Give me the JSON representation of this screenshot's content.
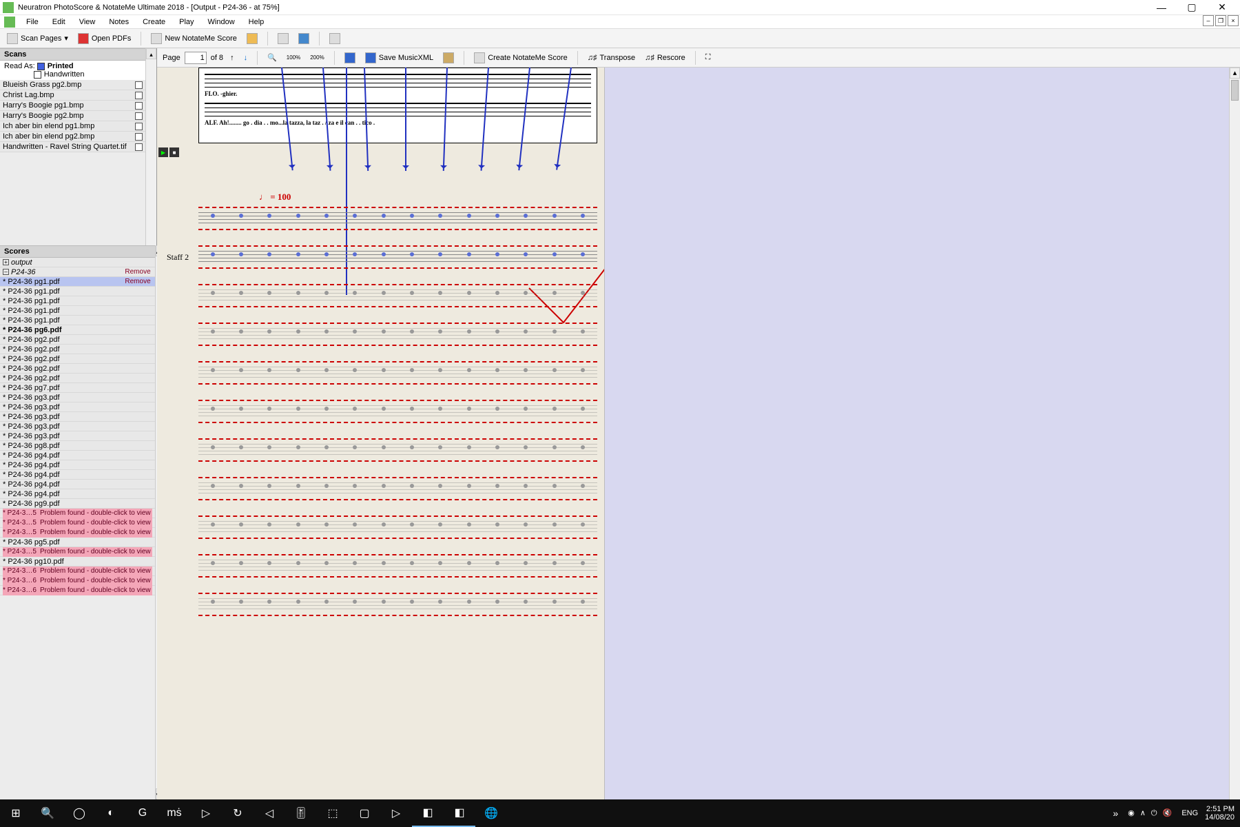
{
  "window": {
    "title": "Neuratron PhotoScore & NotateMe Ultimate 2018 - [Output - P24-36 - at 75%]",
    "min": "—",
    "max": "▢",
    "close": "✕"
  },
  "menu": {
    "items": [
      "File",
      "Edit",
      "View",
      "Notes",
      "Create",
      "Play",
      "Window",
      "Help"
    ]
  },
  "toolbar1": {
    "scan": "Scan Pages",
    "dd": "▾",
    "open": "Open PDFs",
    "newnm": "New NotateMe Score"
  },
  "scans": {
    "header": "Scans",
    "readas_label": "Read As:",
    "printed": "Printed",
    "handwritten": "Handwritten",
    "items": [
      "Blueish Grass pg2.bmp",
      "Christ Lag.bmp",
      "Harry's Boogie pg1.bmp",
      "Harry's Boogie pg2.bmp",
      "Ich aber bin elend pg1.bmp",
      "Ich aber bin elend pg2.bmp",
      "Handwritten - Ravel String Quartet.tif"
    ]
  },
  "scores": {
    "header": "Scores",
    "remove": "Remove",
    "output": "output",
    "current": "P24-36",
    "pages": [
      {
        "n": "* P24-36 pg1.pdf",
        "sel": true,
        "rem": true
      },
      {
        "n": "* P24-36 pg1.pdf"
      },
      {
        "n": "* P24-36 pg1.pdf"
      },
      {
        "n": "* P24-36 pg1.pdf"
      },
      {
        "n": "* P24-36 pg1.pdf"
      },
      {
        "n": "* P24-36 pg6.pdf",
        "bold": true
      },
      {
        "n": "* P24-36 pg2.pdf"
      },
      {
        "n": "* P24-36 pg2.pdf"
      },
      {
        "n": "* P24-36 pg2.pdf"
      },
      {
        "n": "* P24-36 pg2.pdf"
      },
      {
        "n": "* P24-36 pg2.pdf"
      },
      {
        "n": "* P24-36 pg7.pdf"
      },
      {
        "n": "* P24-36 pg3.pdf"
      },
      {
        "n": "* P24-36 pg3.pdf"
      },
      {
        "n": "* P24-36 pg3.pdf"
      },
      {
        "n": "* P24-36 pg3.pdf"
      },
      {
        "n": "* P24-36 pg3.pdf"
      },
      {
        "n": "* P24-36 pg8.pdf"
      },
      {
        "n": "* P24-36 pg4.pdf"
      },
      {
        "n": "* P24-36 pg4.pdf"
      },
      {
        "n": "* P24-36 pg4.pdf"
      },
      {
        "n": "* P24-36 pg4.pdf"
      },
      {
        "n": "* P24-36 pg4.pdf"
      },
      {
        "n": "* P24-36 pg9.pdf"
      },
      {
        "n": "* P24-3…5",
        "prob": true
      },
      {
        "n": "* P24-3…5",
        "prob": true
      },
      {
        "n": "* P24-3…5",
        "prob": true
      },
      {
        "n": "* P24-36 pg5.pdf"
      },
      {
        "n": "* P24-3…5",
        "prob": true
      },
      {
        "n": "* P24-36 pg10.pdf"
      },
      {
        "n": "* P24-3…6",
        "prob": true
      },
      {
        "n": "* P24-3…6",
        "prob": true
      },
      {
        "n": "* P24-3…6",
        "prob": true
      }
    ],
    "problem_msg": "Problem found - double-click to view"
  },
  "doctool": {
    "page_label": "Page",
    "page_val": "1",
    "page_of": "of 8",
    "zoom100": "100%",
    "zoom200": "200%",
    "savexml": "Save MusicXML",
    "createnm": "Create NotateMe Score",
    "transpose": "Transpose",
    "rescore": "Rescore"
  },
  "score": {
    "lyr1": "FLO.    -ghier.",
    "lyr2": "ALF.     Ah!........  go . dia  .   .   mo...la   tazza, la    taz  .  / za e il can  .      . tico .",
    "tempo": "♩ = 100",
    "staff2": "Staff 2"
  },
  "taskbar": {
    "items": [
      "⊞",
      "🔍",
      "◯",
      "◐",
      "G",
      "mṡ",
      "▷",
      "↻",
      "◁",
      "🎚",
      "⬚",
      "▢",
      "▷",
      "◧",
      "◧",
      "🌐"
    ],
    "tray": {
      "chev": "»",
      "icons": [
        "◉",
        "∧",
        "⏻",
        "🔇"
      ],
      "lang": "ENG",
      "time": "2:51 PM",
      "date": "14/08/20"
    }
  }
}
